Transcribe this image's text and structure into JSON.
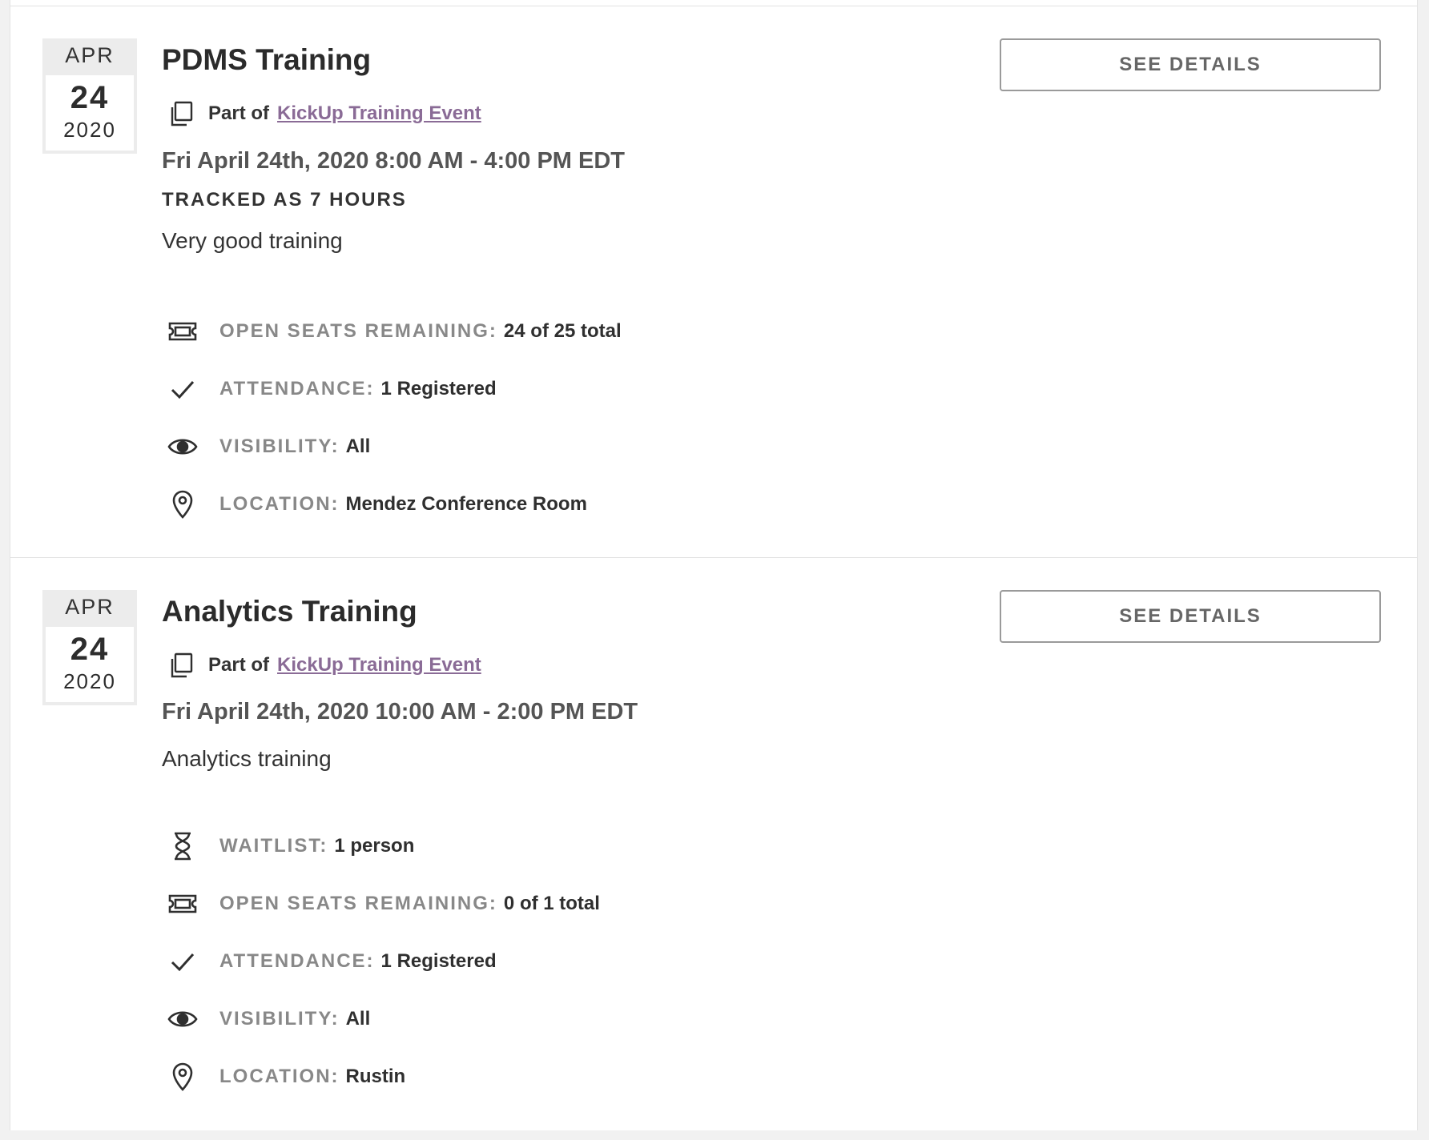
{
  "events": [
    {
      "date": {
        "month": "APR",
        "day": "24",
        "year": "2020"
      },
      "title": "PDMS Training",
      "part_of_label": "Part of",
      "part_of_link": "KickUp Training Event",
      "datetime": "Fri April 24th, 2020 8:00 AM - 4:00 PM EDT",
      "tracked": "TRACKED AS 7 HOURS",
      "description": "Very good training",
      "button": "SEE DETAILS",
      "meta": [
        {
          "icon": "ticket-icon",
          "label": "OPEN SEATS REMAINING:",
          "value": "24 of 25 total"
        },
        {
          "icon": "check-icon",
          "label": "ATTENDANCE:",
          "value": "1 Registered"
        },
        {
          "icon": "eye-icon",
          "label": "VISIBILITY:",
          "value": "All"
        },
        {
          "icon": "location-pin-icon",
          "label": "LOCATION:",
          "value": "Mendez Conference Room"
        }
      ]
    },
    {
      "date": {
        "month": "APR",
        "day": "24",
        "year": "2020"
      },
      "title": "Analytics Training",
      "part_of_label": "Part of",
      "part_of_link": "KickUp Training Event",
      "datetime": "Fri April 24th, 2020 10:00 AM - 2:00 PM EDT",
      "description": "Analytics training",
      "button": "SEE DETAILS",
      "meta": [
        {
          "icon": "hourglass-icon",
          "label": "WAITLIST:",
          "value": "1 person"
        },
        {
          "icon": "ticket-icon",
          "label": "OPEN SEATS REMAINING:",
          "value": "0 of 1 total"
        },
        {
          "icon": "check-icon",
          "label": "ATTENDANCE:",
          "value": "1 Registered"
        },
        {
          "icon": "eye-icon",
          "label": "VISIBILITY:",
          "value": "All"
        },
        {
          "icon": "location-pin-icon",
          "label": "LOCATION:",
          "value": "Rustin"
        }
      ]
    }
  ],
  "colors": {
    "link": "#8a6b96",
    "meta_label": "#888888",
    "background": "#f1f1f1"
  }
}
